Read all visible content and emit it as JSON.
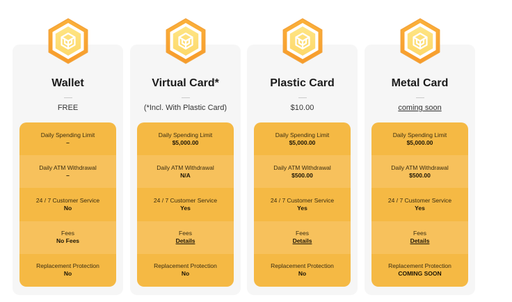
{
  "colors": {
    "accent": "#f5b944",
    "accent_alt": "#f7c15c",
    "badge_outer": "#f79a2a",
    "badge_inner": "#fdd86a",
    "card_bg": "#f6f6f6"
  },
  "badge_icon": "cube-logo-icon",
  "labels": {
    "spending": "Daily Spending Limit",
    "atm": "Daily ATM Withdrawal",
    "service": "24 / 7 Customer Service",
    "fees": "Fees",
    "replacement": "Replacement Protection"
  },
  "plans": [
    {
      "title": "Wallet",
      "price": "FREE",
      "spending": "–",
      "atm": "–",
      "service": "No",
      "fees": "No Fees",
      "replacement": "No"
    },
    {
      "title": "Virtual Card*",
      "price": "(*Incl. With Plastic Card)",
      "spending": "$5,000.00",
      "atm": "N/A",
      "service": "Yes",
      "fees": "Details",
      "replacement": "No"
    },
    {
      "title": "Plastic Card",
      "price": "$10.00",
      "spending": "$5,000.00",
      "atm": "$500.00",
      "service": "Yes",
      "fees": "Details",
      "replacement": "No"
    },
    {
      "title": "Metal Card",
      "price": "coming soon",
      "spending": "$5,000.00",
      "atm": "$500.00",
      "service": "Yes",
      "fees": "Details",
      "replacement": "COMING SOON"
    }
  ]
}
